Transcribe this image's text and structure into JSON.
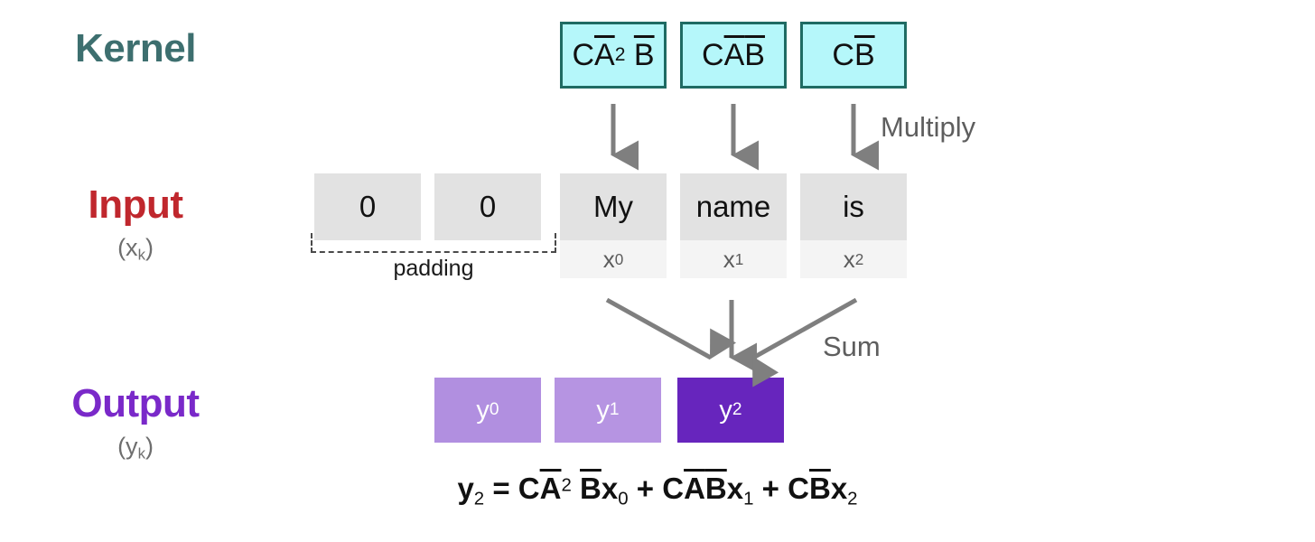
{
  "rows": {
    "kernel": {
      "title": "Kernel",
      "sub": ""
    },
    "input": {
      "title": "Input",
      "sub_open": "(x",
      "sub_idx": "k",
      "sub_close": ")"
    },
    "output": {
      "title": "Output",
      "sub_open": "(y",
      "sub_idx": "k",
      "sub_close": ")"
    }
  },
  "kernel": {
    "items": [
      {
        "prefix": "C",
        "a": "A",
        "exp": "2",
        "b": "B",
        "text": "CA̅2 B̅"
      },
      {
        "prefix": "C",
        "a": "A",
        "exp": "",
        "b": "B",
        "text": "CA̅B̅"
      },
      {
        "prefix": "C",
        "a": "",
        "exp": "",
        "b": "B",
        "text": "CB̅"
      }
    ]
  },
  "input": {
    "padding_cells": [
      {
        "value": "0"
      },
      {
        "value": "0"
      }
    ],
    "padding_label": "padding",
    "tokens": [
      {
        "word": "My",
        "var": "x",
        "idx": "0"
      },
      {
        "word": "name",
        "var": "x",
        "idx": "1"
      },
      {
        "word": "is",
        "var": "x",
        "idx": "2"
      }
    ]
  },
  "output": {
    "cells": [
      {
        "var": "y",
        "idx": "0",
        "highlighted": false,
        "color": "#b18fe0"
      },
      {
        "var": "y",
        "idx": "1",
        "highlighted": false,
        "color": "#b694e2"
      },
      {
        "var": "y",
        "idx": "2",
        "highlighted": true,
        "color": "#6725bd"
      }
    ]
  },
  "flow": {
    "multiply_label": "Multiply",
    "sum_label": "Sum",
    "arrow_color": "#7f7f7f"
  },
  "equation": {
    "lhs_var": "y",
    "lhs_idx": "2",
    "eq": "=",
    "term1": {
      "c": "C",
      "a": "A",
      "exp": "2",
      "b": "B",
      "x": "x",
      "x_idx": "0"
    },
    "plus1": "+",
    "term2": {
      "c": "C",
      "a": "A",
      "exp": "",
      "b": "B",
      "x": "x",
      "x_idx": "1"
    },
    "plus2": "+",
    "term3": {
      "c": "C",
      "a": "",
      "exp": "",
      "b": "B",
      "x": "x",
      "x_idx": "2"
    },
    "text": "y2 = CA̅2 B̅x0 + CA̅B̅x1 + CB̅x2"
  },
  "colors": {
    "kernel_accent": "#3d6f6f",
    "kernel_fill": "#b5f7fa",
    "kernel_border": "#1f6b63",
    "input_accent": "#c0272d",
    "input_fill": "#e2e2e2",
    "input_index_fill": "#f4f4f4",
    "output_accent": "#7a29c9",
    "output_light": "#b18fe0",
    "output_dark": "#6725bd",
    "background": "#ffffff"
  }
}
